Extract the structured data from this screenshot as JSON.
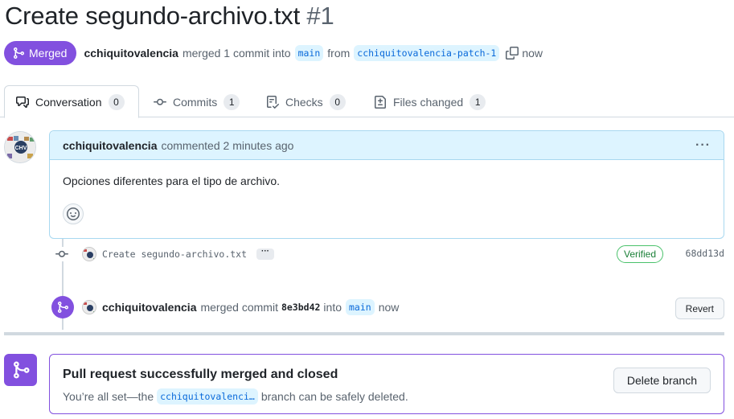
{
  "pr": {
    "title": "Create segundo-archivo.txt",
    "number": "#1",
    "state": "Merged",
    "author": "cchiquitovalencia",
    "action_text": "merged 1 commit into",
    "base_branch": "main",
    "from_text": "from",
    "head_branch": "cchiquitovalencia-patch-1",
    "time": "now"
  },
  "tabs": [
    {
      "label": "Conversation",
      "count": "0",
      "icon": "comment-discussion-icon"
    },
    {
      "label": "Commits",
      "count": "1",
      "icon": "git-commit-icon"
    },
    {
      "label": "Checks",
      "count": "0",
      "icon": "checklist-icon"
    },
    {
      "label": "Files changed",
      "count": "1",
      "icon": "file-diff-icon"
    }
  ],
  "comment": {
    "author": "cchiquitovalencia",
    "meta": "commented 2 minutes ago",
    "body": "Opciones diferentes para el tipo de archivo."
  },
  "commit": {
    "message": "Create segundo-archivo.txt",
    "ellipsis": "···",
    "verified": "Verified",
    "sha": "68dd13d"
  },
  "merge_event": {
    "author": "cchiquitovalencia",
    "text": "merged commit",
    "sha": "8e3bd42",
    "into_text": "into",
    "branch": "main",
    "time": "now",
    "revert_label": "Revert"
  },
  "merged_box": {
    "title": "Pull request successfully merged and closed",
    "prefix": "You’re all set—the",
    "branch": "cchiquitovalenci…",
    "suffix": "branch can be safely deleted.",
    "delete_label": "Delete branch"
  },
  "colors": {
    "merged_purple": "#8250df",
    "link_blue": "#0969da",
    "verified_green": "#1a7f37"
  }
}
